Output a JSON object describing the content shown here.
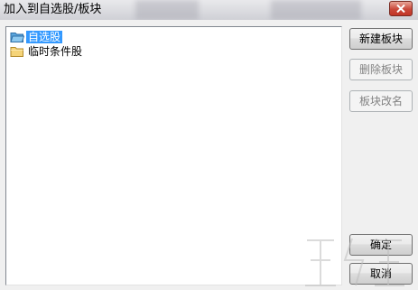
{
  "window": {
    "title": "加入到自选股/板块"
  },
  "tree": {
    "items": [
      {
        "label": "自选股",
        "selected": true,
        "icon": "folder-open-icon"
      },
      {
        "label": "临时条件股",
        "selected": false,
        "icon": "folder-icon"
      }
    ]
  },
  "buttons": {
    "new_block": "新建板块",
    "delete_block": "删除板块",
    "rename_block": "板块改名",
    "ok": "确定",
    "cancel": "取消"
  },
  "colors": {
    "selection": "#3399ff",
    "close_button": "#c9483a",
    "folder": "#f5d479"
  }
}
